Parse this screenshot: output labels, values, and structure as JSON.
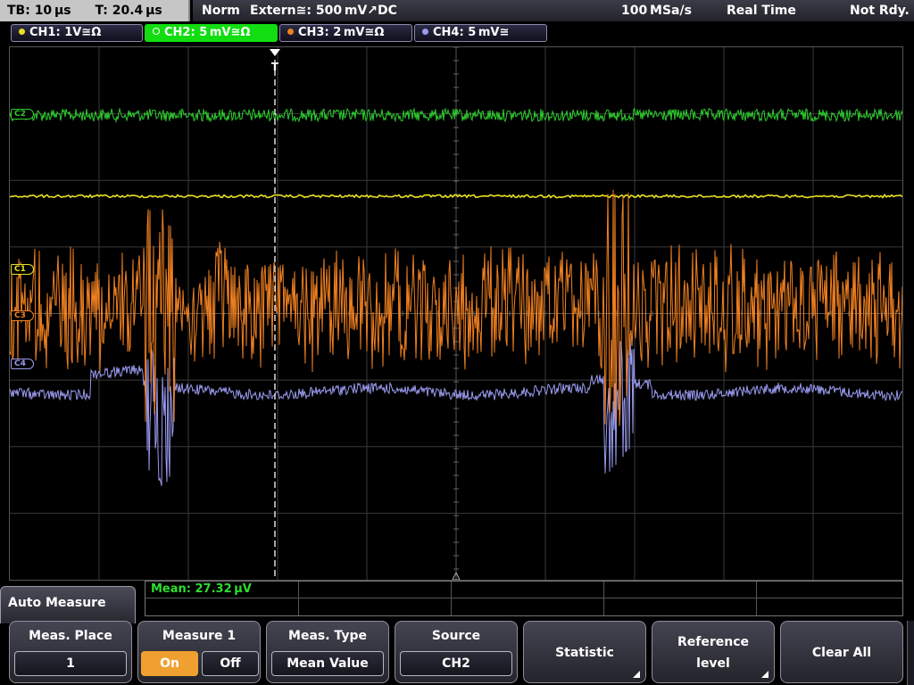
{
  "status": {
    "timebase": "TB: 10 µs",
    "trigger_time": "T: 20.4 µs",
    "mode": "Norm",
    "trigger_source": "Extern≅: 500 mV↗DC",
    "sample_rate": "100 MSa/s",
    "acq_mode": "Real Time",
    "state": "Not Rdy."
  },
  "channels": [
    {
      "label": "CH1: 1V≅Ω",
      "color": "#e8e020",
      "marker": "C1"
    },
    {
      "label": "CH2: 5 mV≅Ω",
      "color": "#2ecc2e",
      "marker": "C2"
    },
    {
      "label": "CH3: 2 mV≅Ω",
      "color": "#f08020",
      "marker": "C3"
    },
    {
      "label": "CH4: 5 mV≅",
      "color": "#9a9af0",
      "marker": "C4"
    }
  ],
  "trigger_marker": "T",
  "measurement": {
    "result": "Mean: 27.32 µV"
  },
  "menu": {
    "title": "Auto Measure",
    "softkeys": [
      {
        "label": "Meas. Place",
        "value": "1"
      },
      {
        "label": "Measure 1",
        "on": "On",
        "off": "Off"
      },
      {
        "label": "Meas. Type",
        "value": "Mean Value"
      },
      {
        "label": "Source",
        "value": "CH2"
      },
      {
        "label": "Statistic"
      },
      {
        "label_line1": "Reference",
        "label_line2": "level"
      },
      {
        "label": "Clear All"
      }
    ]
  }
}
